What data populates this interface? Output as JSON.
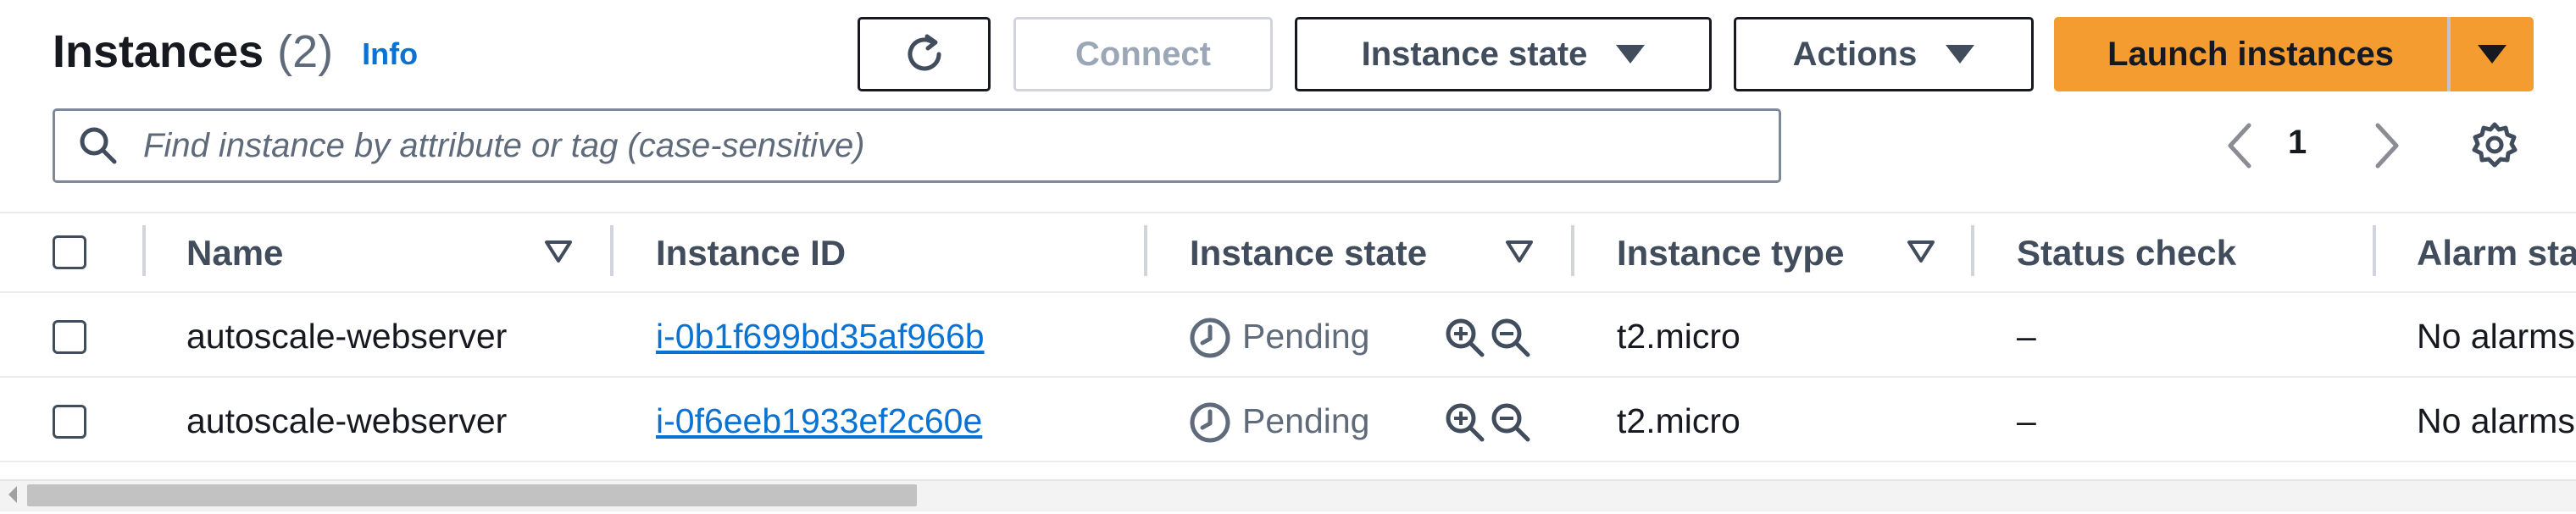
{
  "header": {
    "title": "Instances",
    "count": "(2)",
    "info_link": "Info"
  },
  "toolbar": {
    "refresh_icon": "refresh-icon",
    "connect_label": "Connect",
    "instance_state_label": "Instance state",
    "actions_label": "Actions",
    "launch_label": "Launch instances",
    "launch_color": "#f59c30"
  },
  "search": {
    "placeholder": "Find instance by attribute or tag (case-sensitive)",
    "value": ""
  },
  "pagination": {
    "page": "1"
  },
  "table": {
    "columns": {
      "name": "Name",
      "instance_id": "Instance ID",
      "instance_state": "Instance state",
      "instance_type": "Instance type",
      "status_check": "Status check",
      "alarm_status": "Alarm status"
    },
    "rows": [
      {
        "name": "autoscale-webserver",
        "instance_id": "i-0b1f699bd35af966b",
        "state": "Pending",
        "type": "t2.micro",
        "status_check": "–",
        "alarm_status": "No alarms"
      },
      {
        "name": "autoscale-webserver",
        "instance_id": "i-0f6eeb1933ef2c60e",
        "state": "Pending",
        "type": "t2.micro",
        "status_check": "–",
        "alarm_status": "No alarms"
      }
    ]
  },
  "colors": {
    "link": "#0972d3",
    "text": "#16191f",
    "muted": "#5f6b7a"
  }
}
